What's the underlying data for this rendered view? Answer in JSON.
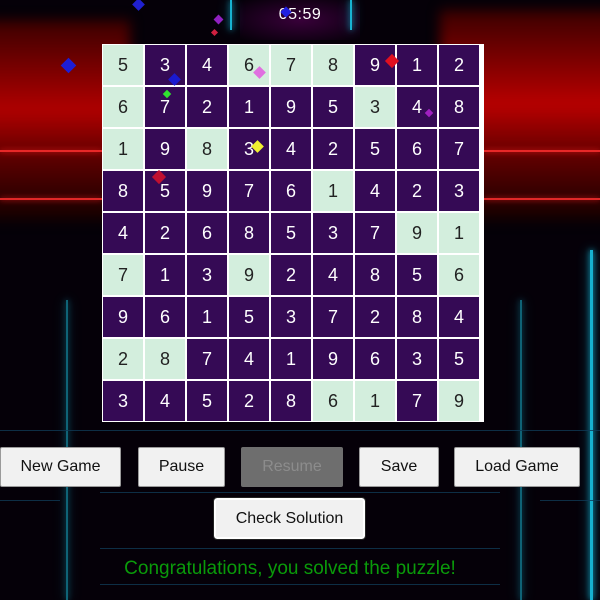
{
  "timer": "05:59",
  "board": [
    [
      "5",
      "3",
      "4",
      "6",
      "7",
      "8",
      "9",
      "1",
      "2"
    ],
    [
      "6",
      "7",
      "2",
      "1",
      "9",
      "5",
      "3",
      "4",
      "8"
    ],
    [
      "1",
      "9",
      "8",
      "3",
      "4",
      "2",
      "5",
      "6",
      "7"
    ],
    [
      "8",
      "5",
      "9",
      "7",
      "6",
      "1",
      "4",
      "2",
      "3"
    ],
    [
      "4",
      "2",
      "6",
      "8",
      "5",
      "3",
      "7",
      "9",
      "1"
    ],
    [
      "7",
      "1",
      "3",
      "9",
      "2",
      "4",
      "8",
      "5",
      "6"
    ],
    [
      "9",
      "6",
      "1",
      "5",
      "3",
      "7",
      "2",
      "8",
      "4"
    ],
    [
      "2",
      "8",
      "7",
      "4",
      "1",
      "9",
      "6",
      "3",
      "5"
    ],
    [
      "3",
      "4",
      "5",
      "2",
      "8",
      "6",
      "1",
      "7",
      "9"
    ]
  ],
  "shading": [
    "LDDLLLDDD",
    "LDDDDDLDD",
    "LDLDDDDDD",
    "DDDDDLDDD",
    "DDDDDDDLL",
    "LDDLDDDDL",
    "DDDDDDDDD",
    "LLDDDDDDD",
    "DDDDDLLDL"
  ],
  "colors": {
    "light_cell": "#d3eedd",
    "dark_cell": "#350a55",
    "message": "#0a9a0a"
  },
  "controls": {
    "new_game": "New Game",
    "pause": "Pause",
    "resume": "Resume",
    "save": "Save",
    "load_game": "Load Game",
    "check_solution": "Check Solution"
  },
  "message": "Congratulations, you solved the puzzle!"
}
